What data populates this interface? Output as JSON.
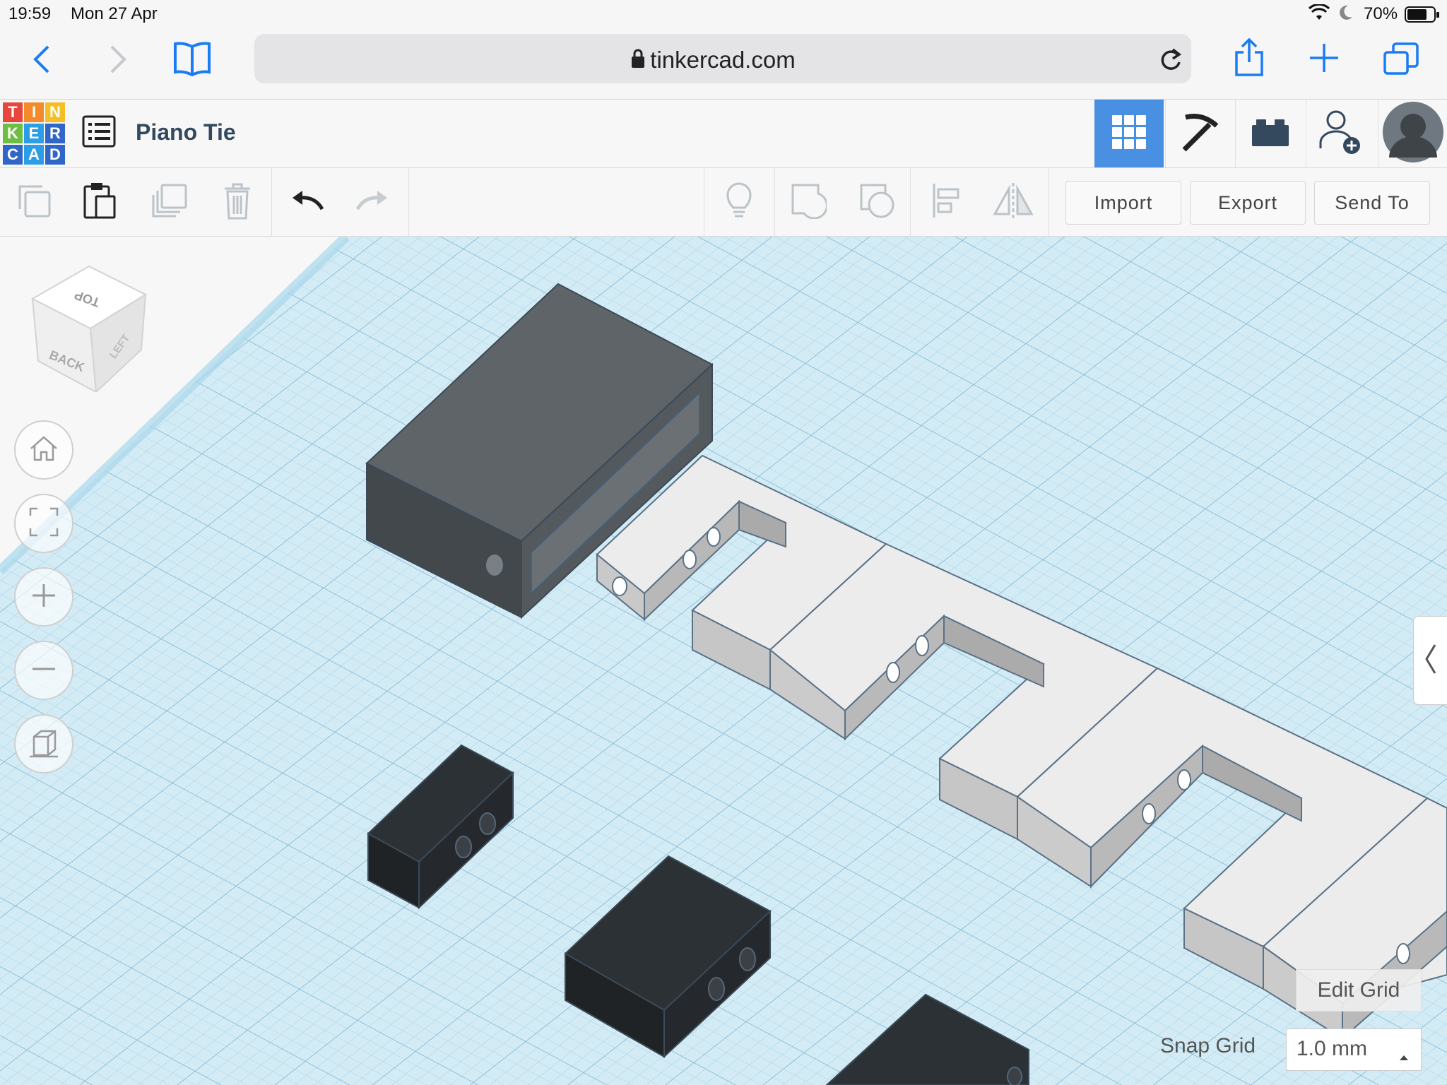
{
  "status": {
    "time": "19:59",
    "date": "Mon 27 Apr",
    "battery": "70%"
  },
  "browser": {
    "url": "tinkercad.com"
  },
  "app": {
    "logo_letters": [
      "T",
      "I",
      "N",
      "K",
      "E",
      "R",
      "C",
      "A",
      "D"
    ],
    "logo_colors": [
      "#e8453c",
      "#f48a2a",
      "#f5bf24",
      "#6cbf43",
      "#2c9de6",
      "#2f66c7",
      "#2f66c7",
      "#2c9de6",
      "#2f66c7"
    ],
    "design_name": "Piano Tie",
    "accent": "#4a90e2"
  },
  "toolbar": {
    "import_label": "Import",
    "export_label": "Export",
    "send_to_label": "Send To"
  },
  "viewcube": {
    "top": "TOP",
    "back": "BACK",
    "left": "LEFT"
  },
  "grid": {
    "edit_label": "Edit Grid",
    "snap_label": "Snap Grid",
    "snap_value": "1.0 mm"
  }
}
